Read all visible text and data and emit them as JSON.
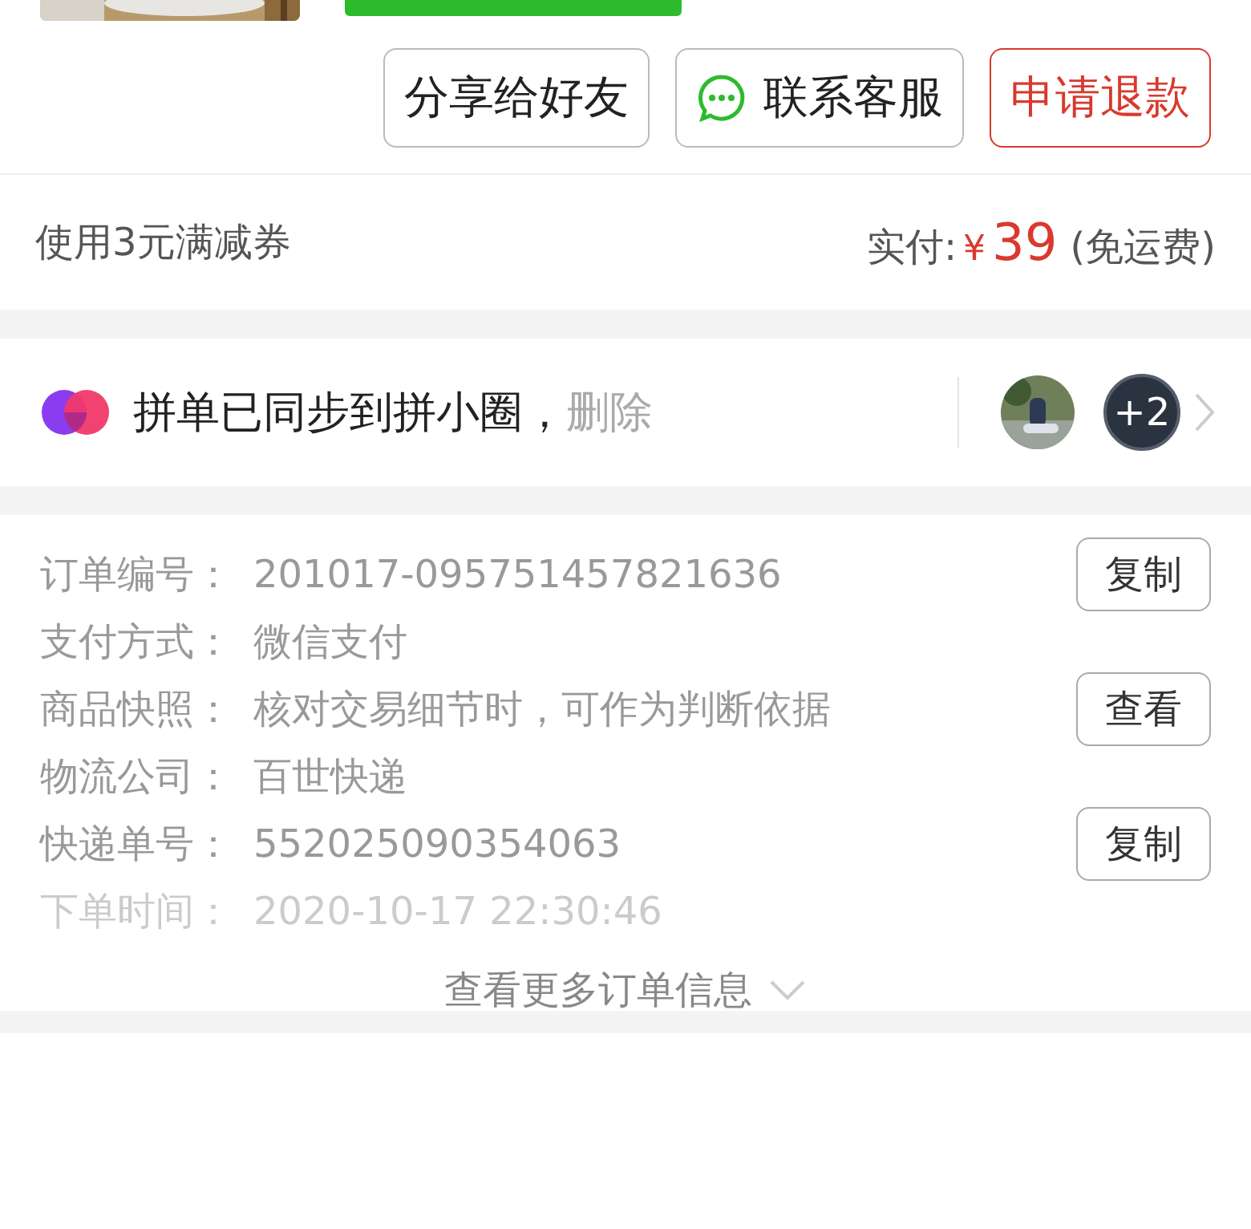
{
  "actions": [
    {
      "label": "分享给好友",
      "kind": "plain"
    },
    {
      "label": "联系客服",
      "kind": "chat"
    },
    {
      "label": "申请退款",
      "kind": "danger"
    }
  ],
  "payment": {
    "coupon": "使用3元满减券",
    "paid_label": "实付:",
    "currency": "¥",
    "amount": "39",
    "shipping": "(免运费)"
  },
  "group": {
    "text": "拼单已同步到拼小圈，",
    "delete_link": "删除",
    "members": [
      {
        "kind": "picture"
      },
      {
        "kind": "count",
        "label": "+2"
      }
    ]
  },
  "order_info": {
    "rows": [
      {
        "label": "订单编号：",
        "value": "201017-095751457821636",
        "button": "复制",
        "faded": false
      },
      {
        "label": "支付方式：",
        "value": "微信支付",
        "faded": false
      },
      {
        "label": "商品快照：",
        "value": "核对交易细节时，可作为判断依据",
        "button": "查看",
        "faded": false
      },
      {
        "label": "物流公司：",
        "value": "百世快递",
        "faded": false
      },
      {
        "label": "快递单号：",
        "value": "552025090354063",
        "button": "复制",
        "faded": false
      },
      {
        "label": "下单时间：",
        "value": "2020-10-17 22:30:46",
        "faded": true
      }
    ],
    "more": "查看更多订单信息"
  }
}
